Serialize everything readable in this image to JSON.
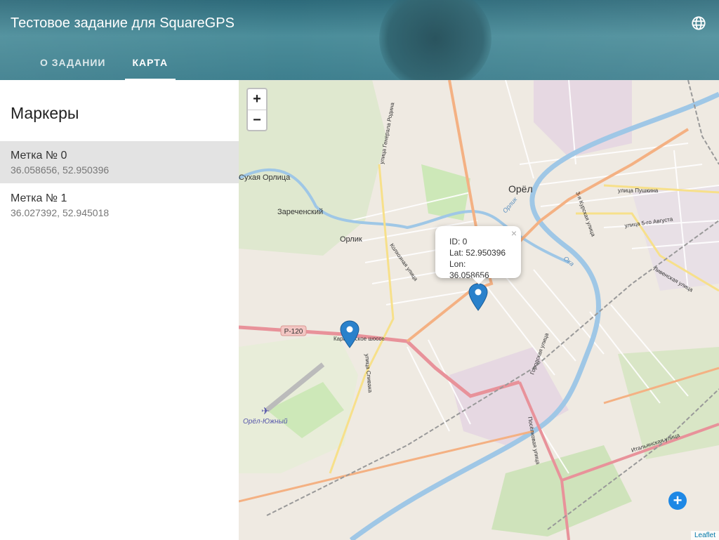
{
  "app": {
    "title": "Тестовое задание для SquareGPS"
  },
  "tabs": [
    {
      "label": "О ЗАДАНИИ"
    },
    {
      "label": "КАРТА"
    }
  ],
  "sidebar": {
    "heading": "Маркеры",
    "markers": [
      {
        "label": "Метка № 0",
        "coords": "36.058656, 52.950396"
      },
      {
        "label": "Метка № 1",
        "coords": "36.027392, 52.945018"
      }
    ]
  },
  "map": {
    "zoom_in": "+",
    "zoom_out": "−",
    "popup": {
      "id": "ID: 0",
      "lat": "Lat: 52.950396",
      "lon": "Lon: 36.058656",
      "close": "×"
    },
    "attribution": "Leaflet",
    "add_button": "+",
    "labels": {
      "sukhaya_orlitsa": "Сухая Орлица",
      "zarechensky": "Зареченский",
      "orlik": "Орлик",
      "orel": "Орёл",
      "orel_yuzhny": "Орёл-Южный",
      "r120": "Р-120",
      "karachevskoe": "Карачевское шоссе",
      "pushkina": "улица Пушкина",
      "pyatogo_avgusta": "улица 5-го Августа",
      "livenskaya": "Ливенская улица",
      "italyanskaya": "Итальянская улица",
      "generala_rodina": "улица Генерала Родина",
      "kolkhoznaya": "Колхозная улица",
      "gorodskaya": "Городская улица",
      "poselkovaya": "Посёлковая улица",
      "kurskaya": "3-я Курская улица",
      "spivaka": "улица Спивака",
      "oka": "Ока",
      "orlik_river": "Орлик"
    },
    "colors": {
      "marker": "#2a81cb",
      "major_road": "#f4b183",
      "primary_road": "#e8929a",
      "river": "#9fc7e6",
      "park": "#cde8b8"
    }
  }
}
